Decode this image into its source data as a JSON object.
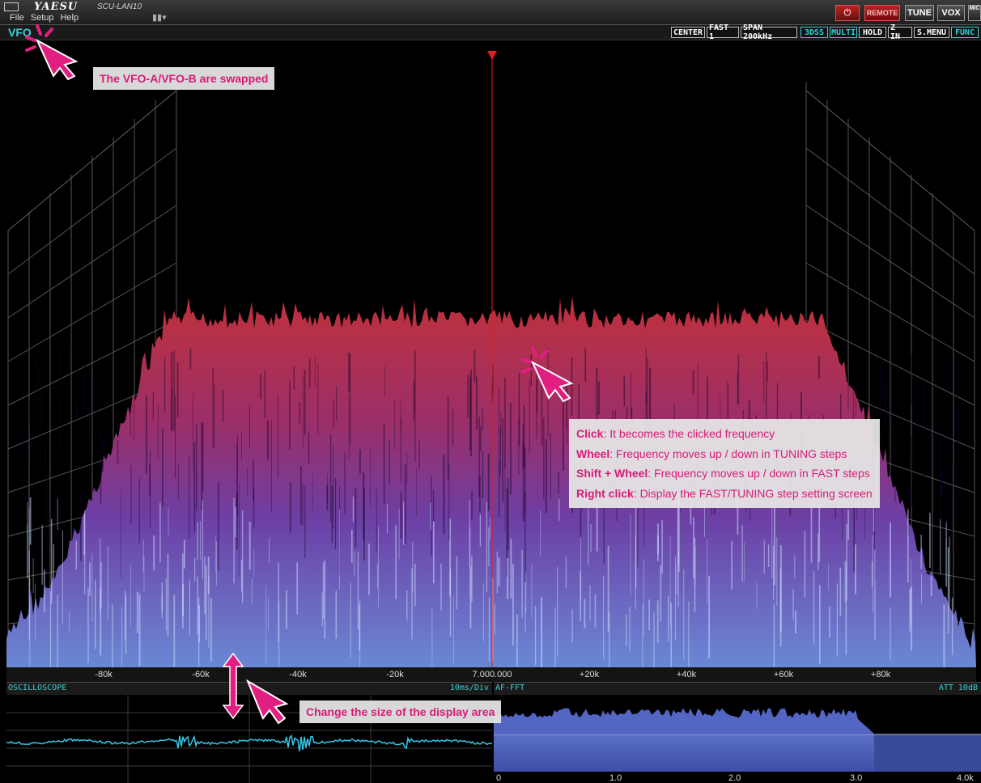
{
  "window": {
    "brand": "YAESU",
    "app_name": "SCU-LAN10",
    "menu": [
      "File",
      "Setup",
      "Help"
    ]
  },
  "title_buttons": {
    "remote": "REMOTE",
    "tune": "TUNE",
    "vox": "VOX",
    "mic": "MIC"
  },
  "vfo": {
    "label": "VFO",
    "buttons": [
      "CENTER",
      "FAST 1",
      "SPAN 200kHz",
      "3DSS",
      "MULTI",
      "HOLD",
      "Z IN",
      "S.MENU",
      "FUNC"
    ]
  },
  "frequency_axis": {
    "center": "7.000.000",
    "labels": [
      "-80k",
      "-60k",
      "-40k",
      "-20k",
      "7.000.000",
      "+20k",
      "+40k",
      "+60k",
      "+80k"
    ]
  },
  "oscilloscope": {
    "title": "OSCILLOSCOPE",
    "timebase": "10ms/Div"
  },
  "af_fft": {
    "title": "AF-FFT",
    "att": "ATT 10dB",
    "ticks": [
      "0",
      "1.0",
      "2.0",
      "3.0",
      "4.0k"
    ]
  },
  "annotations": {
    "vfo_swap": "The VFO-A/VFO-B are swapped",
    "resize": "Change the size of the display area",
    "controls": [
      {
        "key": "Click",
        "text": ": It becomes the clicked frequency"
      },
      {
        "key": "Wheel",
        "text": ": Frequency moves up / down in TUNING steps"
      },
      {
        "key": "Shift + Wheel",
        "text": ": Frequency moves up / down in FAST steps"
      },
      {
        "key": "Right click",
        "text": ": Display the FAST/TUNING step setting screen"
      }
    ]
  },
  "colors": {
    "accent_cyan": "#3cd0d8",
    "annotation_pink": "#d81b78",
    "spectrum_top": "#c0303a",
    "spectrum_bottom": "#5a6fc8"
  }
}
